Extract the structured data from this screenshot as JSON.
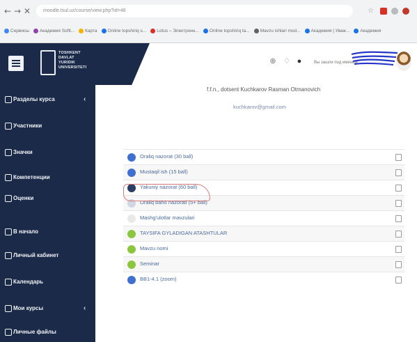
{
  "browser": {
    "nav": {
      "back": "←",
      "forward": "→",
      "reload": "✕"
    },
    "url": "moodle.tsul.uz/course/view.php?id=48",
    "bookmarks": [
      {
        "label": "Сервисы",
        "color": "#4285f4"
      },
      {
        "label": "Академия Softl...",
        "color": "#8e44ad"
      },
      {
        "label": "Карта",
        "color": "#f4b400"
      },
      {
        "label": "Online topshiriq s...",
        "color": "#1a73e8"
      },
      {
        "label": "Lotus – Электронн...",
        "color": "#d93025"
      },
      {
        "label": "Online topshiriq ta...",
        "color": "#1a73e8"
      },
      {
        "label": "Mavzu ishlari mod...",
        "color": "#5f6368"
      },
      {
        "label": "Академия | Уваж...",
        "color": "#1a73e8"
      },
      {
        "label": "Академия",
        "color": "#1a73e8"
      }
    ]
  },
  "header": {
    "logo_text": [
      "TOSHKENT",
      "DAVLAT",
      "YURIDIK",
      "UNIVERSITETI"
    ],
    "user_name": "Вы зашли под именем"
  },
  "sidebar": {
    "items": [
      {
        "label": "Разделы курса",
        "chevron": "‹"
      },
      {
        "label": "Участники"
      },
      {
        "label": "Значки"
      },
      {
        "label": "Компетенции"
      },
      {
        "label": "Оценки"
      },
      {
        "label": "В начало"
      },
      {
        "label": "Личный кабинет"
      },
      {
        "label": "Календарь"
      },
      {
        "label": "Мои курсы",
        "chevron": "‹"
      },
      {
        "label": "Личные файлы"
      }
    ]
  },
  "main": {
    "teacher": "f.f.n., dotsent Kuchkarov Rasman Otmanovich",
    "email": "kuchkarov@gmail.com",
    "activities": [
      {
        "label": "Oraliq nazorat (30 ball)",
        "color": "#3f6fd1"
      },
      {
        "label": "Mustaqil ish (15 ball)",
        "color": "#3f6fd1"
      },
      {
        "label": "Yakuniy nazorat (60 ball)",
        "color": "#2c3e66"
      },
      {
        "label": "Oraliq baho nazorati (5+ ball)",
        "color": "#cfd6e4"
      },
      {
        "label": "Mashg'ulotlar mavzulari",
        "color": "#e9e9e9"
      },
      {
        "label": "TAYSIFA GYLADIGAN ATASHTULAR",
        "color": "#8cc63f"
      },
      {
        "label": "Mavzu nomi",
        "color": "#8cc63f"
      },
      {
        "label": "Seminar",
        "color": "#8cc63f"
      },
      {
        "label": "BB1-4.1 (zoom)",
        "color": "#3f6fd1"
      }
    ]
  }
}
